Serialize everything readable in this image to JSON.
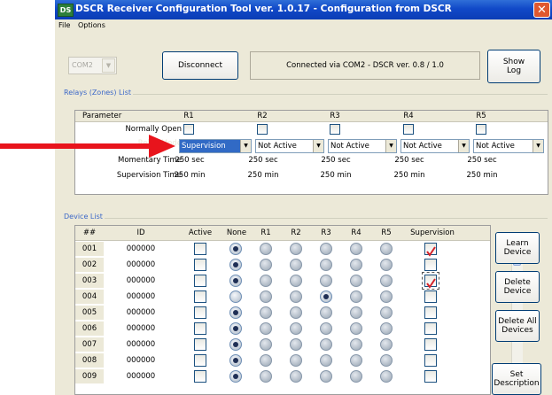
{
  "window": {
    "title": "DSCR Receiver Configuration Tool ver. 1.0.17 - Configuration from DSCR",
    "app_icon": "DS",
    "close_symbol": "✕"
  },
  "menu": [
    "File",
    "Options"
  ],
  "connection": {
    "port_value": "COM2",
    "port_arrow": "▼",
    "disconnect_label": "Disconnect",
    "status": "Connected via COM2 - DSCR ver. 0.8 / 1.0",
    "show_log_label": "Show Log"
  },
  "relays": {
    "group_label": "Relays (Zones) List",
    "header_param": "Parameter",
    "columns": [
      "R1",
      "R2",
      "R3",
      "R4",
      "R5"
    ],
    "params": [
      "Normally Open",
      "Relay Mode",
      "Momentary Time",
      "Supervision Time"
    ],
    "modes": [
      "Supervision",
      "Not Active",
      "Not Active",
      "Not Active",
      "Not Active"
    ],
    "momentary": [
      "250 sec",
      "250 sec",
      "250 sec",
      "250 sec",
      "250 sec"
    ],
    "supervision_time": [
      "250 min",
      "250 min",
      "250 min",
      "250 min",
      "250 min"
    ],
    "selected_mode_bg": "#316ac5"
  },
  "devices": {
    "group_label": "Device List",
    "headers": [
      "##",
      "ID",
      "Active",
      "None",
      "R1",
      "R2",
      "R3",
      "R4",
      "R5",
      "Supervision"
    ],
    "rows": [
      {
        "num": "001",
        "id": "000000",
        "selected": "none",
        "supervision": true
      },
      {
        "num": "002",
        "id": "000000",
        "selected": "none",
        "supervision": false
      },
      {
        "num": "003",
        "id": "000000",
        "selected": "none",
        "supervision": true
      },
      {
        "num": "004",
        "id": "000000",
        "selected": "R3",
        "supervision": false
      },
      {
        "num": "005",
        "id": "000000",
        "selected": "none",
        "supervision": false
      },
      {
        "num": "006",
        "id": "000000",
        "selected": "none",
        "supervision": false
      },
      {
        "num": "007",
        "id": "000000",
        "selected": "none",
        "supervision": false
      },
      {
        "num": "008",
        "id": "000000",
        "selected": "none",
        "supervision": false
      },
      {
        "num": "009",
        "id": "000000",
        "selected": "none",
        "supervision": false
      }
    ],
    "buttons": {
      "learn": "Learn Device",
      "delete": "Delete Device",
      "delete_all": "Delete All Devices",
      "set_description": "Set Description"
    },
    "checkmark_color": "#d4232a"
  },
  "annotation": {
    "arrow_color": "#e8141c"
  }
}
